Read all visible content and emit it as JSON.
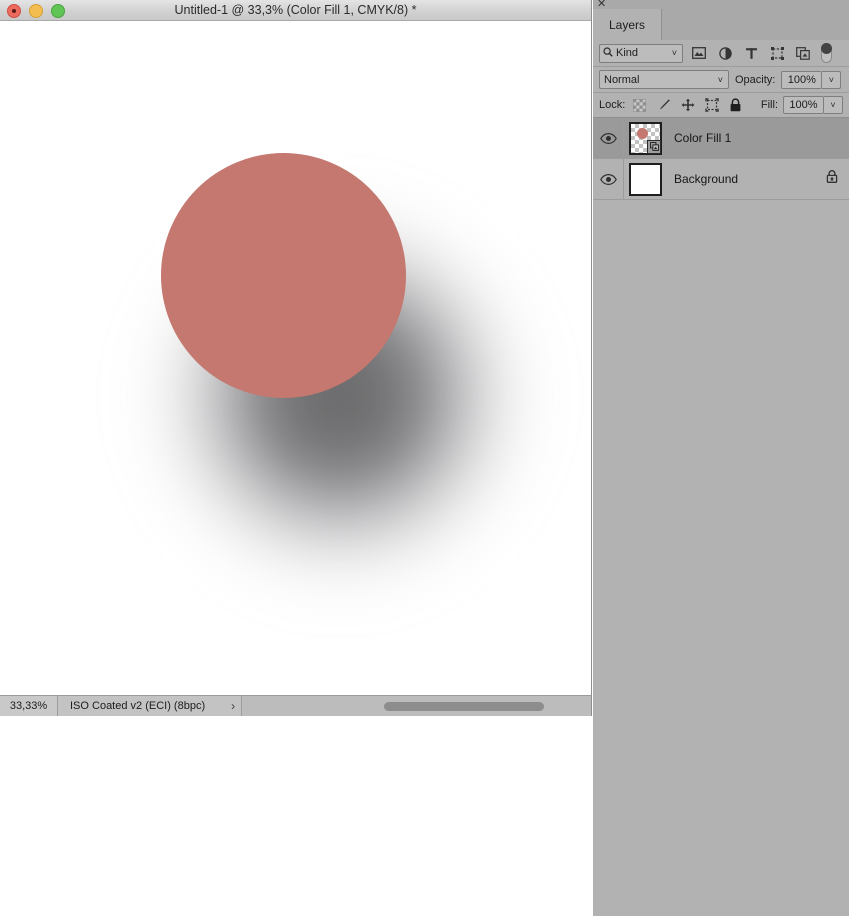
{
  "window": {
    "title": "Untitled-1 @ 33,3% (Color Fill 1, CMYK/8) *",
    "traffic_lights": {
      "close": "close-button",
      "minimize": "minimize-button",
      "maximize": "maximize-button"
    }
  },
  "canvas": {
    "shape_color": "#c4786f",
    "background_color": "#ffffff",
    "shadow_color": "#37373a"
  },
  "statusbar": {
    "zoom": "33,33%",
    "color_profile": "ISO Coated v2 (ECI) (8bpc)",
    "expand_arrow": "›"
  },
  "panel": {
    "close_glyph": "✕",
    "tabs": [
      {
        "label": "Layers",
        "active": true
      }
    ],
    "filter": {
      "kind_label": "Kind",
      "search_icon": "search-icon",
      "type_icons": [
        "pixel-layer-filter-icon",
        "adjustment-layer-filter-icon",
        "type-layer-filter-icon",
        "shape-layer-filter-icon",
        "smart-object-filter-icon"
      ],
      "toggle": "filter-enable-toggle",
      "caret": "˅"
    },
    "blend": {
      "mode": "Normal",
      "opacity_label": "Opacity:",
      "opacity_value": "100%",
      "caret": "˅"
    },
    "lock": {
      "label": "Lock:",
      "icons": [
        "lock-transparent-pixels-icon",
        "lock-image-pixels-icon",
        "lock-position-icon",
        "lock-artboard-nesting-icon",
        "lock-all-icon"
      ],
      "fill_label": "Fill:",
      "fill_value": "100%"
    },
    "layers": [
      {
        "name": "Color Fill 1",
        "visible": true,
        "selected": true,
        "thumb_type": "transparent-with-shape",
        "has_smart_badge": true,
        "locked": false
      },
      {
        "name": "Background",
        "visible": true,
        "selected": false,
        "thumb_type": "white",
        "has_smart_badge": false,
        "locked": true
      }
    ]
  }
}
